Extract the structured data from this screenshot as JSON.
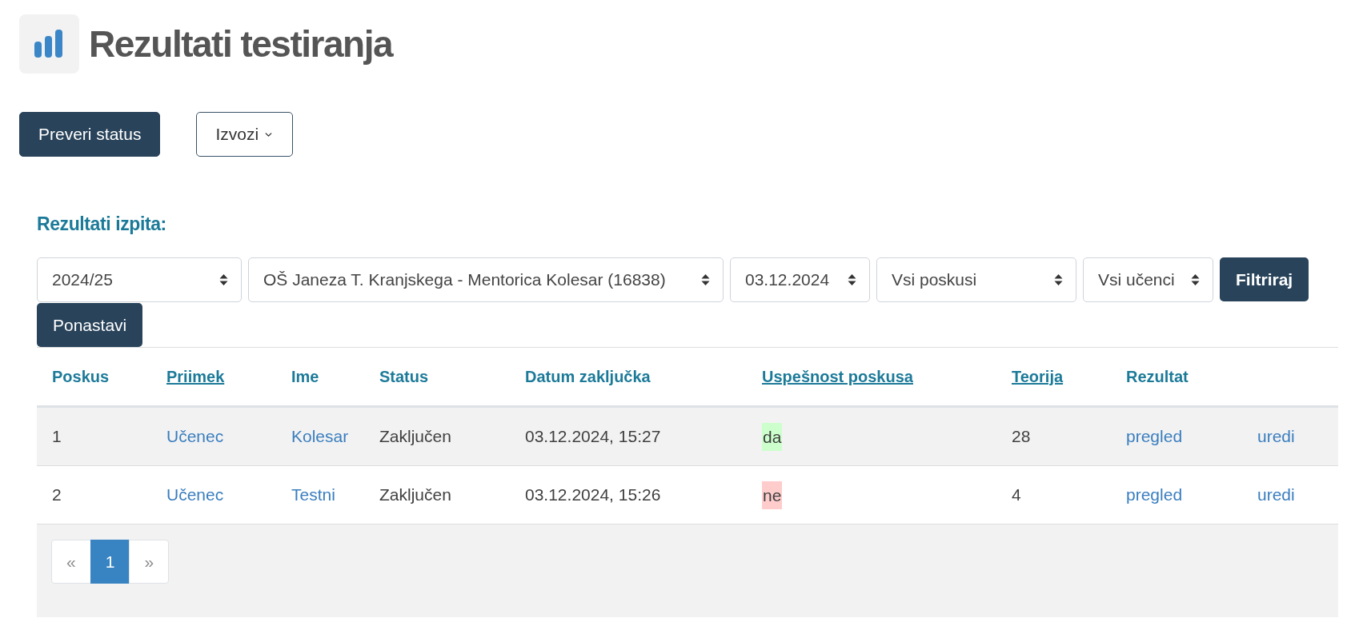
{
  "header": {
    "title": "Rezultati testiranja"
  },
  "toolbar": {
    "buttons": [
      {
        "label": "Preveri status",
        "kind": "primary"
      },
      {
        "label": "Izvozi",
        "kind": "dropdown"
      }
    ]
  },
  "results": {
    "heading": "Rezultati izpita:",
    "filters": [
      {
        "value": "2024/25"
      },
      {
        "value": "OŠ Janeza T. Kranjskega - Mentorica Kolesar (16838)"
      },
      {
        "value": "03.12.2024"
      },
      {
        "value": "Vsi poskusi"
      },
      {
        "value": "Vsi učenci"
      }
    ],
    "filter_buttons": [
      {
        "label": "Filtriraj",
        "kind": "submit"
      },
      {
        "label": "Ponastavi",
        "kind": "reset"
      }
    ],
    "table": {
      "columns": [
        {
          "label": "Poskus",
          "sortable": false
        },
        {
          "label": "Priimek",
          "sortable": true
        },
        {
          "label": "Ime",
          "sortable": false
        },
        {
          "label": "Status",
          "sortable": false
        },
        {
          "label": "Datum zaključka",
          "sortable": false
        },
        {
          "label": "Uspešnost poskusa",
          "sortable": true
        },
        {
          "label": "Teorija",
          "sortable": true
        },
        {
          "label": "Rezultat",
          "sortable": false
        }
      ],
      "rows": [
        {
          "attempt": "1",
          "surname": "Učenec",
          "first_name": "Kolesar",
          "status": "Zaključen",
          "completed_at": "03.12.2024, 15:27",
          "attempt_success": {
            "text": "da",
            "color": "#ccffcc"
          },
          "theory": "28",
          "result": "pregled",
          "column_9": "uredi"
        },
        {
          "attempt": "2",
          "surname": "Učenec",
          "first_name": "Testni",
          "status": "Zaključen",
          "completed_at": "03.12.2024, 15:26",
          "attempt_success": {
            "text": "ne",
            "color": "#ffcccc"
          },
          "theory": "4",
          "result": "pregled",
          "column_9": "uredi"
        }
      ]
    },
    "pagination": [
      {
        "label": "«",
        "kind": "previous",
        "selected": false,
        "disabled": true
      },
      {
        "label": "1",
        "kind": "page",
        "selected": true,
        "disabled": false
      },
      {
        "label": "»",
        "kind": "next",
        "selected": false,
        "disabled": true
      }
    ]
  }
}
